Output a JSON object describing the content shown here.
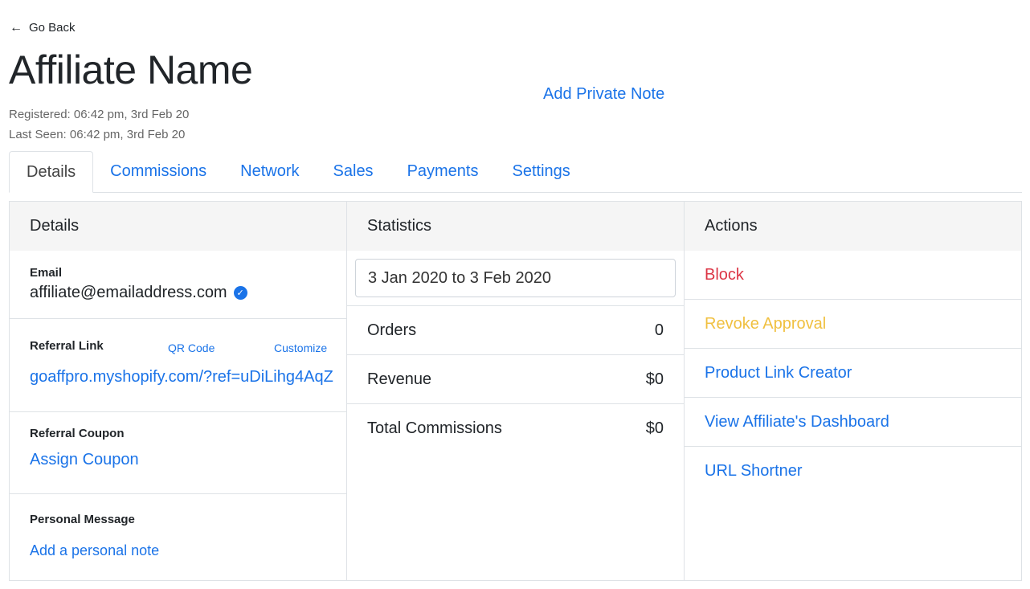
{
  "nav": {
    "back_label": "Go Back",
    "back_icon": "arrow-left-icon"
  },
  "header": {
    "title": "Affiliate Name",
    "registered": "Registered: 06:42 pm, 3rd Feb 20",
    "last_seen": "Last Seen: 06:42 pm, 3rd Feb 20",
    "private_note_label": "Add Private Note"
  },
  "tabs": [
    {
      "label": "Details",
      "active": true
    },
    {
      "label": "Commissions"
    },
    {
      "label": "Network"
    },
    {
      "label": "Sales"
    },
    {
      "label": "Payments"
    },
    {
      "label": "Settings"
    }
  ],
  "details": {
    "heading": "Details",
    "email_label": "Email",
    "email_value": "affiliate@emailaddress.com",
    "referral_link_label": "Referral Link",
    "qr_code_label": "QR Code",
    "customize_label": "Customize",
    "referral_link_value": "goaffpro.myshopify.com/?ref=uDiLihg4AqZ",
    "referral_coupon_label": "Referral Coupon",
    "assign_coupon_label": "Assign Coupon",
    "personal_message_label": "Personal Message",
    "personal_note_label": "Add a personal note"
  },
  "statistics": {
    "heading": "Statistics",
    "date_range": "3 Jan 2020 to 3 Feb 2020",
    "rows": [
      {
        "label": "Orders",
        "value": "0"
      },
      {
        "label": "Revenue",
        "value": "$0"
      },
      {
        "label": "Total Commissions",
        "value": "$0"
      }
    ]
  },
  "actions": {
    "heading": "Actions",
    "items": [
      {
        "label": "Block",
        "color": "#dc3545"
      },
      {
        "label": "Revoke Approval",
        "color": "#f0c040"
      },
      {
        "label": "Product Link Creator",
        "color": "#1a73e8"
      },
      {
        "label": "View Affiliate's Dashboard",
        "color": "#1a73e8"
      },
      {
        "label": "URL Shortner",
        "color": "#1a73e8"
      }
    ]
  },
  "colors": {
    "link": "#1a73e8",
    "danger": "#dc3545",
    "warning": "#f0c040",
    "panel_header_bg": "#f5f5f5"
  }
}
